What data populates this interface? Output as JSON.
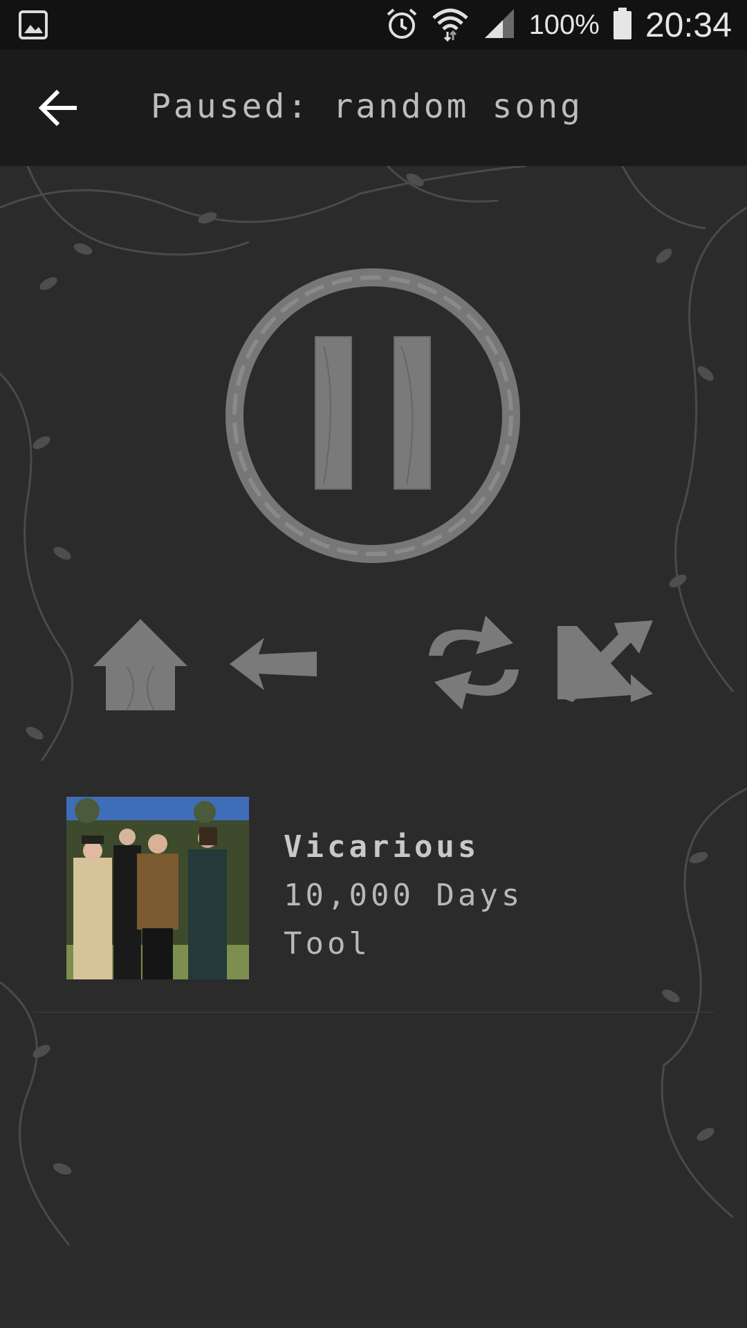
{
  "status_bar": {
    "battery": "100%",
    "time": "20:34",
    "icons": [
      "image-icon",
      "alarm-icon",
      "wifi-icon",
      "signal-icon",
      "battery-icon"
    ]
  },
  "app_bar": {
    "title": "Paused: random song",
    "back_icon": "arrow-left-icon"
  },
  "controls": {
    "main": "pause-icon",
    "secondary": [
      "home-icon",
      "previous-icon",
      "repeat-icon",
      "shuffle-icon"
    ]
  },
  "track": {
    "title": "Vicarious",
    "album": "10,000 Days",
    "artist": "Tool"
  },
  "colors": {
    "background": "#2b2b2b",
    "status_bar": "#121212",
    "app_bar": "#1b1b1b",
    "control_gray": "#7a7a7a",
    "text": "#bdbdbd"
  }
}
